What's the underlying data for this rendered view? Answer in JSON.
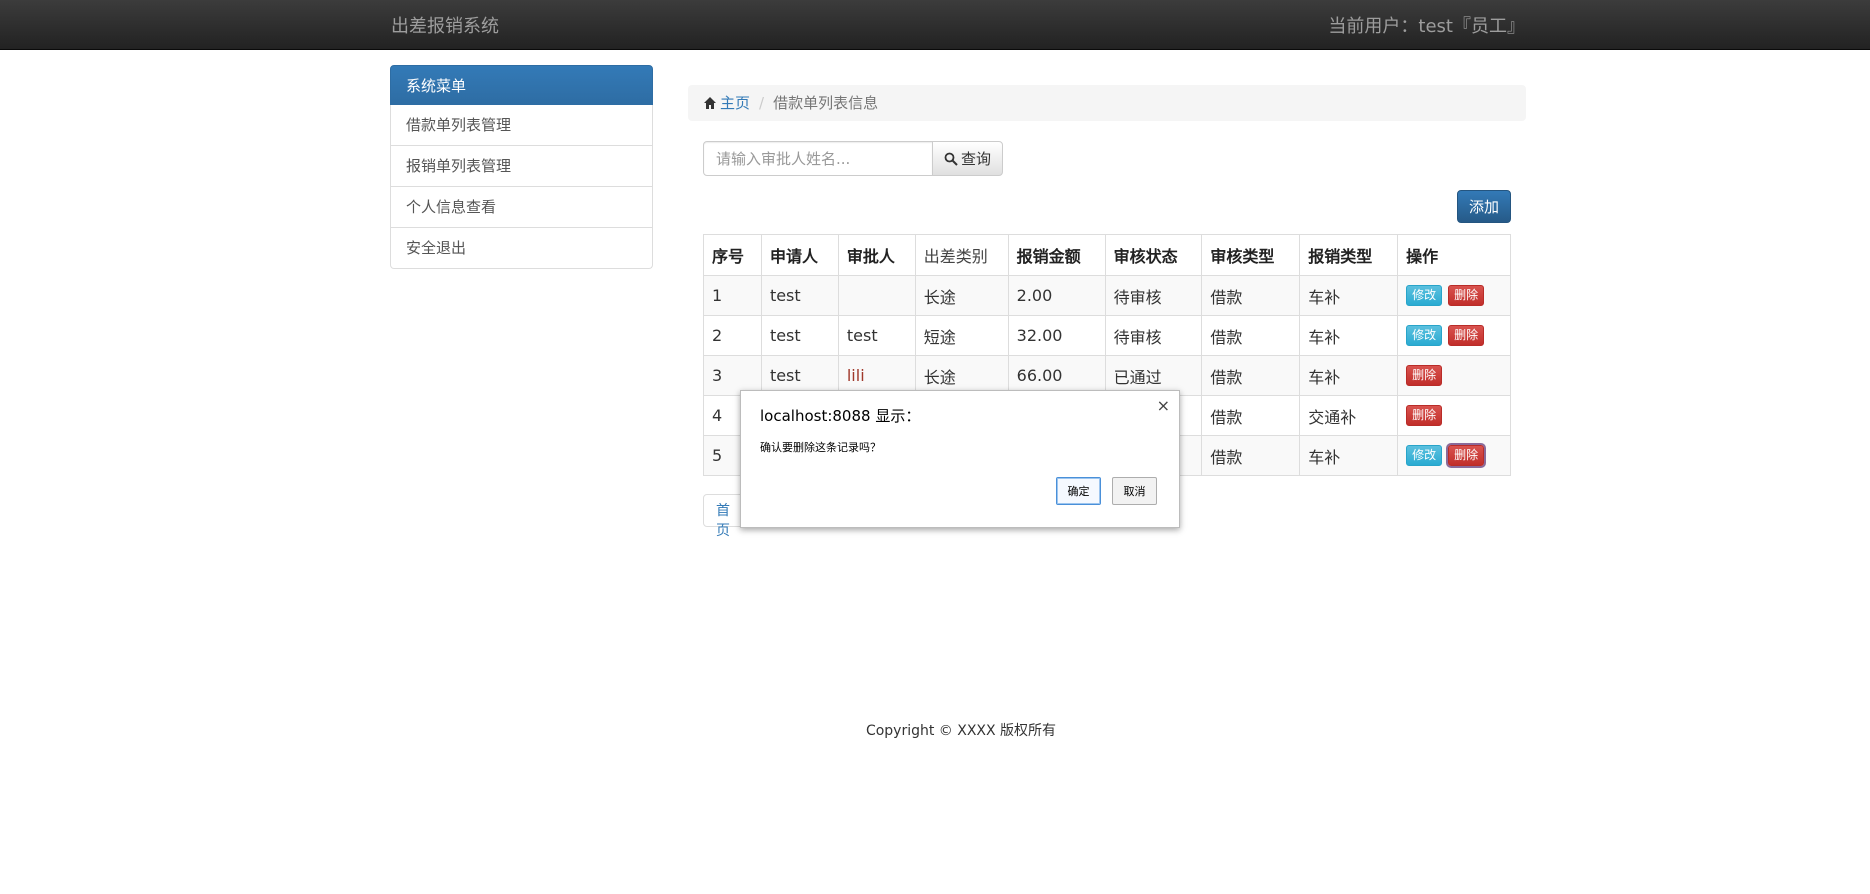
{
  "header": {
    "brand": "出差报销系统",
    "current_user": "当前用户：test『员工』"
  },
  "sidebar": {
    "title": "系统菜单",
    "items": [
      {
        "label": "借款单列表管理"
      },
      {
        "label": "报销单列表管理"
      },
      {
        "label": "个人信息查看"
      },
      {
        "label": "安全退出"
      }
    ]
  },
  "breadcrumb": {
    "home": "主页",
    "current": "借款单列表信息"
  },
  "search": {
    "placeholder": "请输入审批人姓名...",
    "button_label": "查询"
  },
  "add_button": "添加",
  "table": {
    "headers": [
      "序号",
      "申请人",
      "审批人",
      "出差类别",
      "报销金额",
      "审核状态",
      "审核类型",
      "报销类型",
      "操作"
    ],
    "rows": [
      {
        "no": "1",
        "applicant": "test",
        "approver": "",
        "category": "长途",
        "amount": "2.00",
        "status": "待审核",
        "audit_type": "借款",
        "reimb_type": "车补"
      },
      {
        "no": "2",
        "applicant": "test",
        "approver": "test",
        "category": "短途",
        "amount": "32.00",
        "status": "待审核",
        "audit_type": "借款",
        "reimb_type": "车补"
      },
      {
        "no": "3",
        "applicant": "test",
        "approver": "lili",
        "category": "长途",
        "amount": "66.00",
        "status": "已通过",
        "audit_type": "借款",
        "reimb_type": "车补"
      },
      {
        "no": "4",
        "applicant": "",
        "approver": "",
        "category": "",
        "amount": "",
        "status": "",
        "audit_type": "借款",
        "reimb_type": "交通补"
      },
      {
        "no": "5",
        "applicant": "",
        "approver": "",
        "category": "",
        "amount": "",
        "status": "",
        "audit_type": "借款",
        "reimb_type": "车补"
      }
    ],
    "edit_label": "修改",
    "delete_label": "删除"
  },
  "pagination": {
    "first": "首页"
  },
  "footer": "Copyright © XXXX 版权所有",
  "dialog": {
    "title": "localhost:8088 显示：",
    "close": "×",
    "message": "确认要删除这条记录吗？",
    "ok": "确定",
    "cancel": "取消"
  },
  "colors": {
    "navbar": "#222222",
    "primary": "#337ab7",
    "info": "#5bc0de",
    "danger": "#d9534f"
  }
}
